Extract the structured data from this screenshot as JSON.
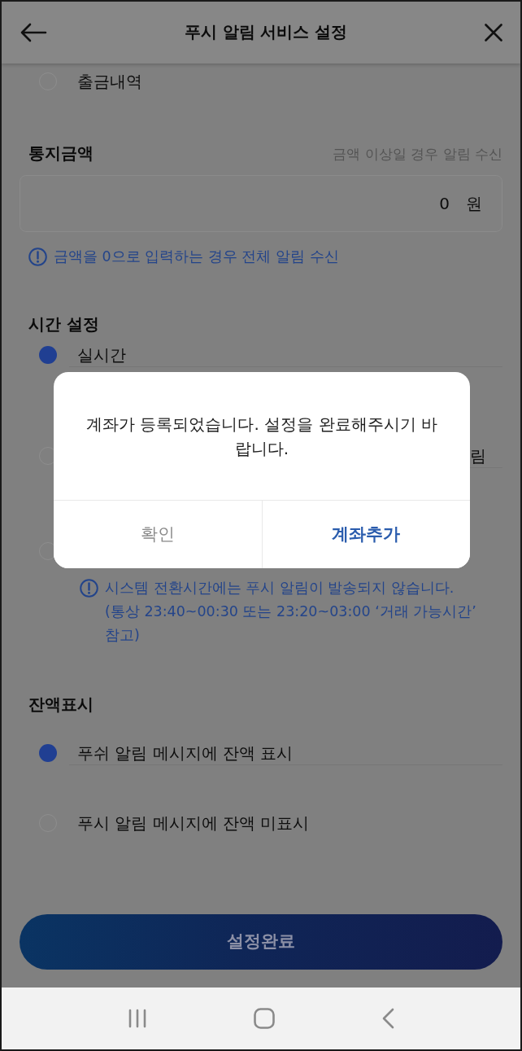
{
  "header": {
    "title": "푸시 알림 서비스 설정"
  },
  "account_options": [
    {
      "label": "출금내역",
      "selected": false
    }
  ],
  "amount": {
    "title": "통지금액",
    "hint": "금액 이상일 경우 알림 수신",
    "value": "0",
    "unit": "원",
    "note": "금액을 0으로 입력하는 경우 전체 알림 수신"
  },
  "time": {
    "title": "시간 설정",
    "options": [
      {
        "label": "실시간",
        "selected": true
      },
      {
        "label_tail": "림",
        "selected": false
      },
      {
        "selected": false
      }
    ],
    "note": "시스템 전환시간에는 푸시 알림이 발송되지 않습니다.\n(통상 23:40~00:30 또는 23:20~03:00 ‘거래 가능시간’ 참고)"
  },
  "balance": {
    "title": "잔액표시",
    "options": [
      {
        "label": "푸쉬 알림 메시지에 잔액 표시",
        "selected": true
      },
      {
        "label": "푸시 알림 메시지에 잔액 미표시",
        "selected": false
      }
    ]
  },
  "submit": {
    "label": "설정완료"
  },
  "dialog": {
    "message": "계좌가 등록되었습니다. 설정을 완료해주시기 바랍니다.",
    "buttons": [
      {
        "label": "확인",
        "kind": "secondary"
      },
      {
        "label": "계좌추가",
        "kind": "primary"
      }
    ]
  }
}
